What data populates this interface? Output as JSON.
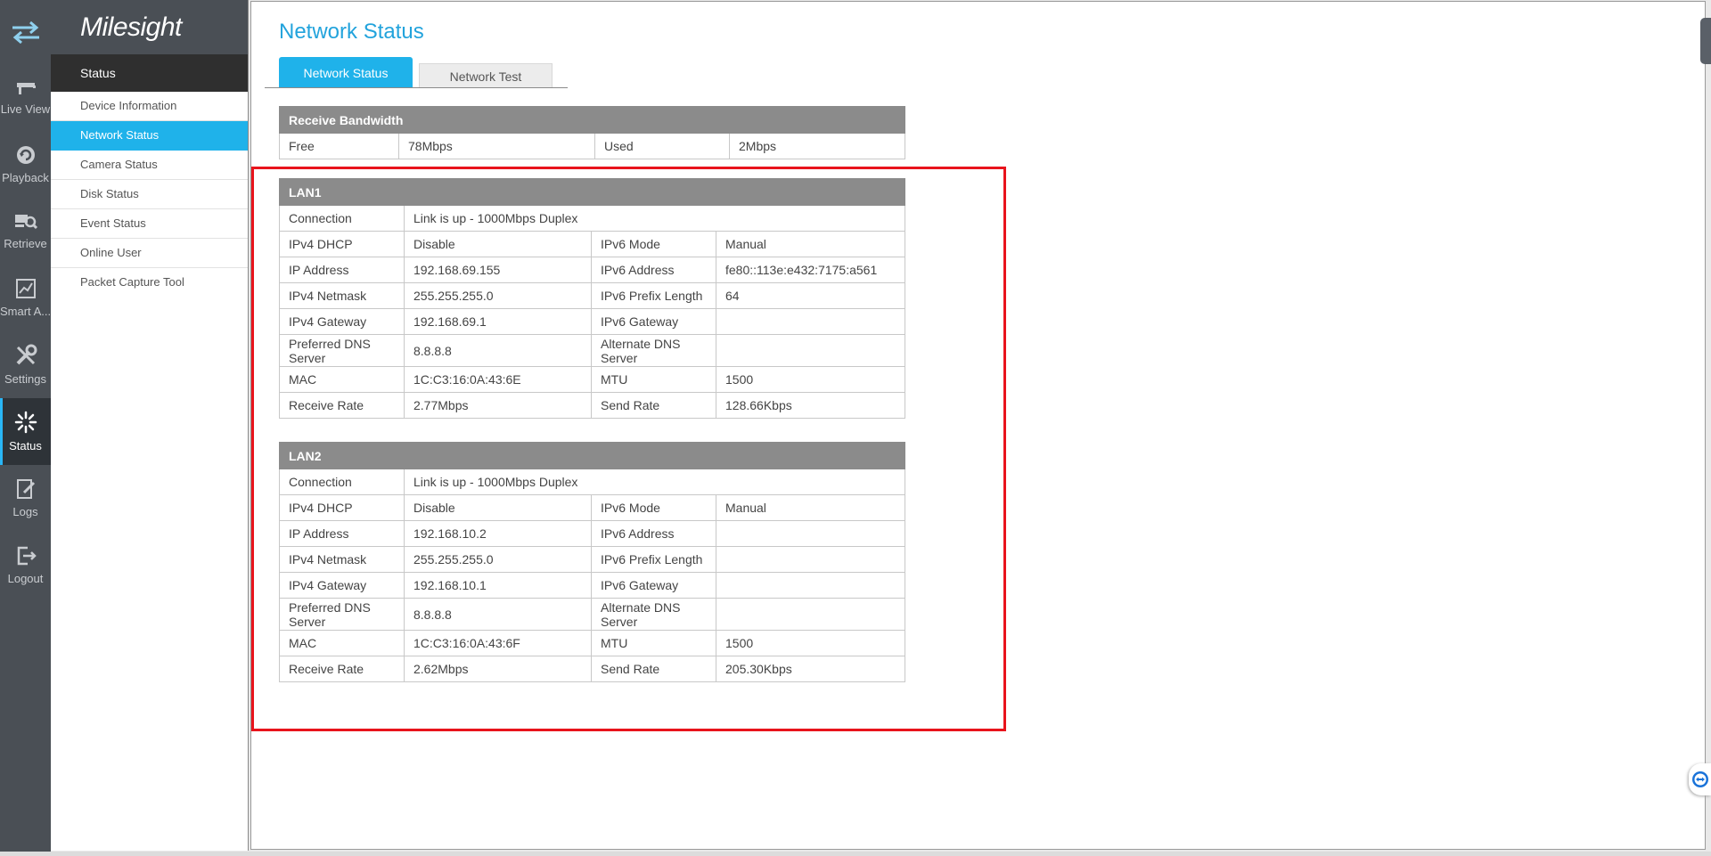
{
  "rail": {
    "items": [
      {
        "label": "Live View",
        "icon": "live-view-icon"
      },
      {
        "label": "Playback",
        "icon": "playback-icon"
      },
      {
        "label": "Retrieve",
        "icon": "retrieve-icon"
      },
      {
        "label": "Smart A...",
        "icon": "smart-analytics-icon"
      },
      {
        "label": "Settings",
        "icon": "settings-icon"
      },
      {
        "label": "Status",
        "icon": "status-icon"
      },
      {
        "label": "Logs",
        "icon": "logs-icon"
      },
      {
        "label": "Logout",
        "icon": "logout-icon"
      }
    ]
  },
  "brand": "Milesight",
  "menu": {
    "header": "Status",
    "items": [
      "Device Information",
      "Network Status",
      "Camera Status",
      "Disk Status",
      "Event Status",
      "Online User",
      "Packet Capture Tool"
    ]
  },
  "page": {
    "title": "Network Status",
    "tabs": [
      "Network Status",
      "Network Test"
    ]
  },
  "bandwidth": {
    "title": "Receive Bandwidth",
    "free_label": "Free",
    "free_value": "78Mbps",
    "used_label": "Used",
    "used_value": "2Mbps"
  },
  "lan1": {
    "title": "LAN1",
    "connection_label": "Connection",
    "connection_value": "Link is up - 1000Mbps Duplex",
    "rows": [
      {
        "l1": "IPv4 DHCP",
        "v1": "Disable",
        "l2": "IPv6 Mode",
        "v2": "Manual"
      },
      {
        "l1": "IP Address",
        "v1": "192.168.69.155",
        "l2": "IPv6 Address",
        "v2": "fe80::113e:e432:7175:a561"
      },
      {
        "l1": "IPv4 Netmask",
        "v1": "255.255.255.0",
        "l2": "IPv6 Prefix Length",
        "v2": "64"
      },
      {
        "l1": "IPv4 Gateway",
        "v1": "192.168.69.1",
        "l2": "IPv6 Gateway",
        "v2": ""
      },
      {
        "l1": "Preferred DNS Server",
        "v1": "8.8.8.8",
        "l2": "Alternate DNS Server",
        "v2": ""
      },
      {
        "l1": "MAC",
        "v1": "1C:C3:16:0A:43:6E",
        "l2": "MTU",
        "v2": "1500"
      },
      {
        "l1": "Receive Rate",
        "v1": "2.77Mbps",
        "l2": "Send Rate",
        "v2": "128.66Kbps"
      }
    ]
  },
  "lan2": {
    "title": "LAN2",
    "connection_label": "Connection",
    "connection_value": "Link is up - 1000Mbps Duplex",
    "rows": [
      {
        "l1": "IPv4 DHCP",
        "v1": "Disable",
        "l2": "IPv6 Mode",
        "v2": "Manual"
      },
      {
        "l1": "IP Address",
        "v1": "192.168.10.2",
        "l2": "IPv6 Address",
        "v2": ""
      },
      {
        "l1": "IPv4 Netmask",
        "v1": "255.255.255.0",
        "l2": "IPv6 Prefix Length",
        "v2": ""
      },
      {
        "l1": "IPv4 Gateway",
        "v1": "192.168.10.1",
        "l2": "IPv6 Gateway",
        "v2": ""
      },
      {
        "l1": "Preferred DNS Server",
        "v1": "8.8.8.8",
        "l2": "Alternate DNS Server",
        "v2": ""
      },
      {
        "l1": "MAC",
        "v1": "1C:C3:16:0A:43:6F",
        "l2": "MTU",
        "v2": "1500"
      },
      {
        "l1": "Receive Rate",
        "v1": "2.62Mbps",
        "l2": "Send Rate",
        "v2": "205.30Kbps"
      }
    ]
  },
  "colors": {
    "accent": "#1fb2ea",
    "highlight_box": "#e8141c",
    "table_header": "#8b8b8b",
    "rail": "#4a4f55"
  }
}
